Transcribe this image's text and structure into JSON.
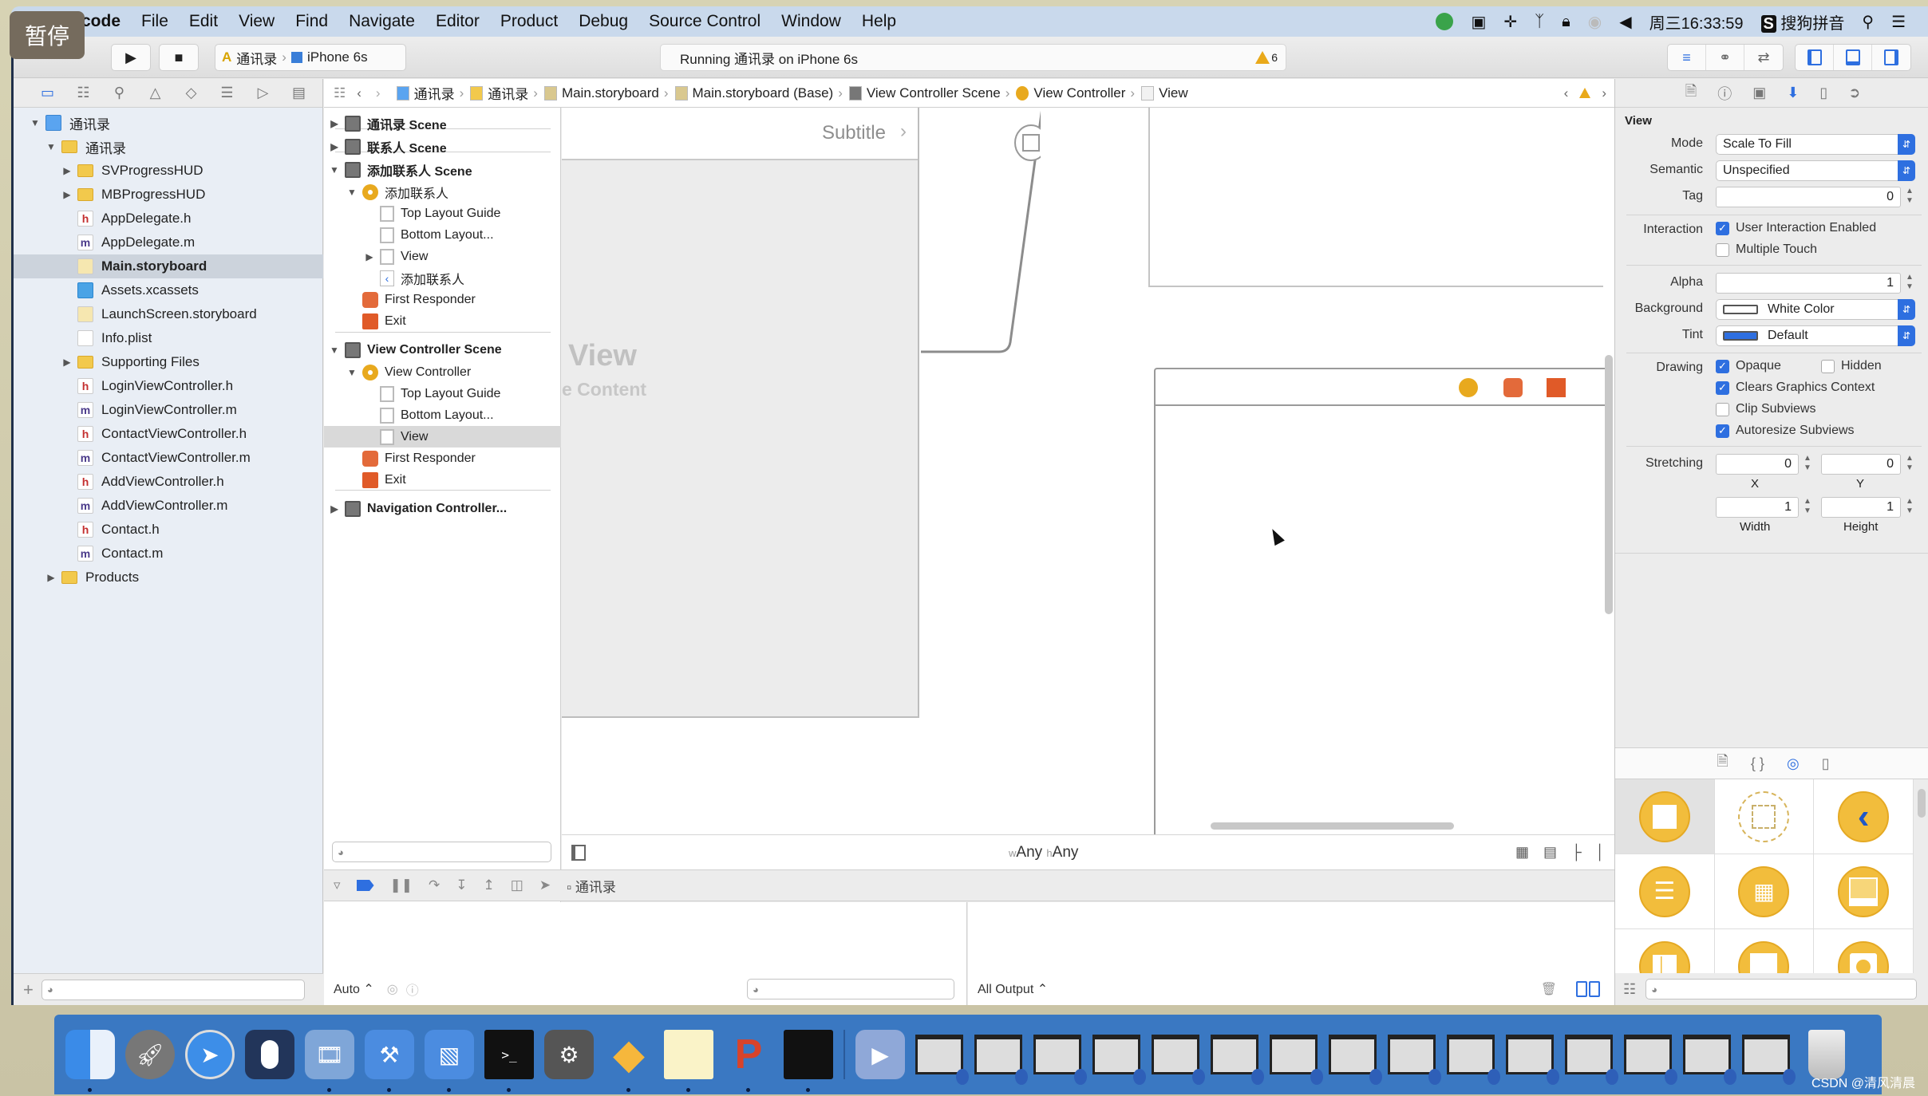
{
  "menubar": {
    "app_name": "Xcode",
    "items": [
      "File",
      "Edit",
      "View",
      "Find",
      "Navigate",
      "Editor",
      "Product",
      "Debug",
      "Source Control",
      "Window",
      "Help"
    ],
    "clock": "周三16:33:59",
    "input_method": "搜狗拼音"
  },
  "overlay": {
    "pause_badge": "暂停"
  },
  "toolbar": {
    "scheme": "通讯录",
    "device": "iPhone 6s",
    "activity": "Running 通讯录 on iPhone 6s",
    "warning_count": "6"
  },
  "jumpbar": {
    "crumbs": [
      "通讯录",
      "通讯录",
      "Main.storyboard",
      "Main.storyboard (Base)",
      "View Controller Scene",
      "View Controller",
      "View"
    ]
  },
  "navigator": {
    "tree": [
      {
        "label": "通讯录",
        "kind": "proj",
        "indent": 0,
        "disclosure": "open"
      },
      {
        "label": "通讯录",
        "kind": "folder",
        "indent": 1,
        "disclosure": "open"
      },
      {
        "label": "SVProgressHUD",
        "kind": "folder",
        "indent": 2,
        "disclosure": "closed"
      },
      {
        "label": "MBProgressHUD",
        "kind": "folder",
        "indent": 2,
        "disclosure": "closed"
      },
      {
        "label": "AppDelegate.h",
        "kind": "h",
        "indent": 2
      },
      {
        "label": "AppDelegate.m",
        "kind": "m",
        "indent": 2
      },
      {
        "label": "Main.storyboard",
        "kind": "sb",
        "indent": 2,
        "selected": true
      },
      {
        "label": "Assets.xcassets",
        "kind": "assets",
        "indent": 2
      },
      {
        "label": "LaunchScreen.storyboard",
        "kind": "sb",
        "indent": 2
      },
      {
        "label": "Info.plist",
        "kind": "plist",
        "indent": 2
      },
      {
        "label": "Supporting Files",
        "kind": "folder",
        "indent": 2,
        "disclosure": "closed"
      },
      {
        "label": "LoginViewController.h",
        "kind": "h",
        "indent": 2
      },
      {
        "label": "LoginViewController.m",
        "kind": "m",
        "indent": 2
      },
      {
        "label": "ContactViewController.h",
        "kind": "h",
        "indent": 2
      },
      {
        "label": "ContactViewController.m",
        "kind": "m",
        "indent": 2
      },
      {
        "label": "AddViewController.h",
        "kind": "h",
        "indent": 2
      },
      {
        "label": "AddViewController.m",
        "kind": "m",
        "indent": 2
      },
      {
        "label": "Contact.h",
        "kind": "h",
        "indent": 2
      },
      {
        "label": "Contact.m",
        "kind": "m",
        "indent": 2
      },
      {
        "label": "Products",
        "kind": "folder",
        "indent": 1,
        "disclosure": "closed"
      }
    ]
  },
  "outline": {
    "rows": [
      {
        "label": "通讯录 Scene",
        "kind": "scene",
        "indent": 0,
        "disclosure": "closed",
        "bold": true
      },
      {
        "label": "联系人 Scene",
        "kind": "scene",
        "indent": 0,
        "disclosure": "closed",
        "bold": true
      },
      {
        "label": "添加联系人 Scene",
        "kind": "scene",
        "indent": 0,
        "disclosure": "open",
        "bold": true
      },
      {
        "label": "添加联系人",
        "kind": "vc",
        "indent": 1,
        "disclosure": "open"
      },
      {
        "label": "Top Layout Guide",
        "kind": "guide",
        "indent": 2
      },
      {
        "label": "Bottom Layout...",
        "kind": "guide",
        "indent": 2
      },
      {
        "label": "View",
        "kind": "guide",
        "indent": 2,
        "disclosure": "closed"
      },
      {
        "label": "添加联系人",
        "kind": "back",
        "indent": 2
      },
      {
        "label": "First Responder",
        "kind": "fr",
        "indent": 1
      },
      {
        "label": "Exit",
        "kind": "exit",
        "indent": 1
      },
      {
        "label": "View Controller Scene",
        "kind": "scene",
        "indent": 0,
        "disclosure": "open",
        "bold": true
      },
      {
        "label": "View Controller",
        "kind": "vc",
        "indent": 1,
        "disclosure": "open"
      },
      {
        "label": "Top Layout Guide",
        "kind": "guide",
        "indent": 2
      },
      {
        "label": "Bottom Layout...",
        "kind": "guide",
        "indent": 2
      },
      {
        "label": "View",
        "kind": "guide",
        "indent": 2,
        "selected": true
      },
      {
        "label": "First Responder",
        "kind": "fr",
        "indent": 1
      },
      {
        "label": "Exit",
        "kind": "exit",
        "indent": 1
      },
      {
        "label": "Navigation Controller...",
        "kind": "scene",
        "indent": 0,
        "disclosure": "closed",
        "bold": true
      }
    ]
  },
  "canvas": {
    "subtitle": "Subtitle",
    "placeholder_title": "View",
    "placeholder_sub": "e Content",
    "size_class_w": "Any",
    "size_class_h": "Any",
    "w_prefix": "w",
    "h_prefix": "h"
  },
  "debug": {
    "process": "通讯录",
    "vars_scope": "Auto ⌃",
    "console_scope": "All Output ⌃"
  },
  "inspector": {
    "section": "View",
    "mode_label": "Mode",
    "mode": "Scale To Fill",
    "semantic_label": "Semantic",
    "semantic": "Unspecified",
    "tag_label": "Tag",
    "tag": "0",
    "interaction_label": "Interaction",
    "user_interaction": {
      "label": "User Interaction Enabled",
      "checked": true
    },
    "multiple_touch": {
      "label": "Multiple Touch",
      "checked": false
    },
    "alpha_label": "Alpha",
    "alpha": "1",
    "background_label": "Background",
    "background": "White Color",
    "tint_label": "Tint",
    "tint": "Default",
    "drawing_label": "Drawing",
    "opaque": {
      "label": "Opaque",
      "checked": true
    },
    "hidden": {
      "label": "Hidden",
      "checked": false
    },
    "clears_context": {
      "label": "Clears Graphics Context",
      "checked": true
    },
    "clip_subviews": {
      "label": "Clip Subviews",
      "checked": false
    },
    "autoresize": {
      "label": "Autoresize Subviews",
      "checked": true
    },
    "stretching_label": "Stretching",
    "stretch_x": "0",
    "stretch_y": "0",
    "stretch_w": "1",
    "stretch_h": "1",
    "x_label": "X",
    "y_label": "Y",
    "width_label": "Width",
    "height_label": "Height"
  },
  "colors": {
    "accent": "#2e6fe0",
    "warning": "#e9a91a",
    "vc_yellow": "#e8a91e",
    "exit_orange": "#e05a28",
    "dock": "#3a78c2"
  },
  "dock": {
    "apps": [
      "Finder",
      "Launchpad",
      "Safari",
      "Mouse",
      "Photo Theater",
      "Xcode",
      "Simulator",
      "Terminal",
      "System Preferences",
      "Sketch",
      "Notes",
      "PowerPoint",
      "Console",
      "Media Player"
    ],
    "window_count": 15
  },
  "watermark": "CSDN @清风清晨"
}
